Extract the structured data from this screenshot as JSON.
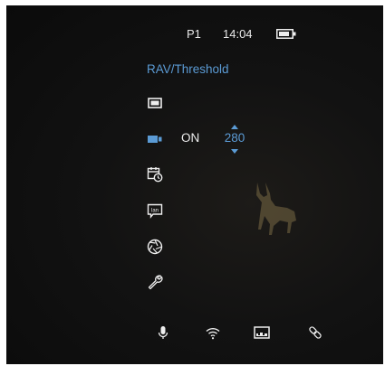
{
  "status_bar": {
    "profile": "P1",
    "time": "14:04"
  },
  "menu": {
    "title": "RAV/Threshold"
  },
  "threshold": {
    "state": "ON",
    "value": "280"
  },
  "colors": {
    "accent": "#5b9bd5",
    "text": "#ececec",
    "background": "#111111"
  },
  "icons": {
    "status": [
      "battery-icon"
    ],
    "menu": [
      "display-mode-icon",
      "video-camera-icon",
      "calendar-clock-icon",
      "language-icon",
      "shutter-icon",
      "wrench-icon"
    ],
    "bottom_bar": [
      "microphone-icon",
      "wifi-icon",
      "image-frame-icon",
      "link-icon"
    ]
  }
}
